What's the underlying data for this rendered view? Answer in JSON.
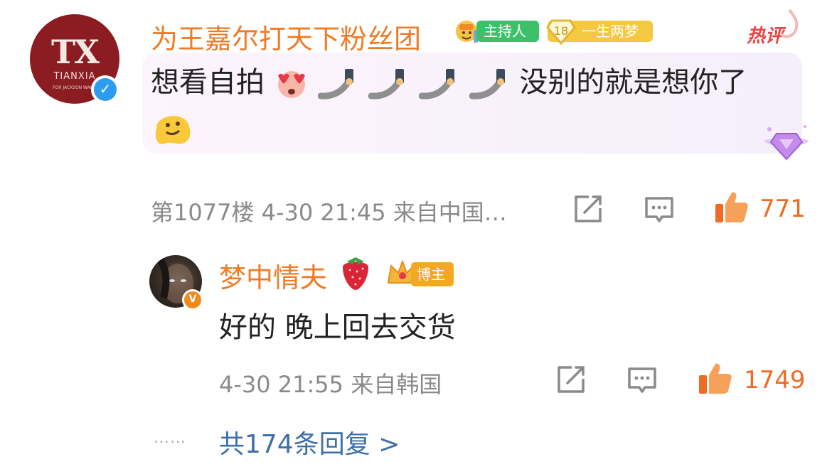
{
  "comment": {
    "avatar_text": "TX",
    "avatar_sub": "TIANXIA",
    "avatar_caption": "FOR JACKSON WANG",
    "username": "为王嘉尔打天下粉丝团",
    "badge_host": "主持人",
    "fan_level": "18",
    "fan_badge": "一生两梦",
    "hot_label": "热评",
    "text_before": "想看自拍",
    "text_after": "没别的就是想你了",
    "meta": "第1077楼 4-30 21:45 来自中国…",
    "likes": "771"
  },
  "reply": {
    "username": "梦中情夫",
    "badge": "博主",
    "text": "好的 晚上回去交货",
    "meta": "4-30 21:55 来自韩国",
    "likes": "1749"
  },
  "more": {
    "dots": "……",
    "label": "共174条回复 >"
  },
  "colors": {
    "username": "#ef7b27",
    "like": "#ef6a23",
    "link": "#3d6fa8",
    "meta": "#8a8a8a"
  }
}
